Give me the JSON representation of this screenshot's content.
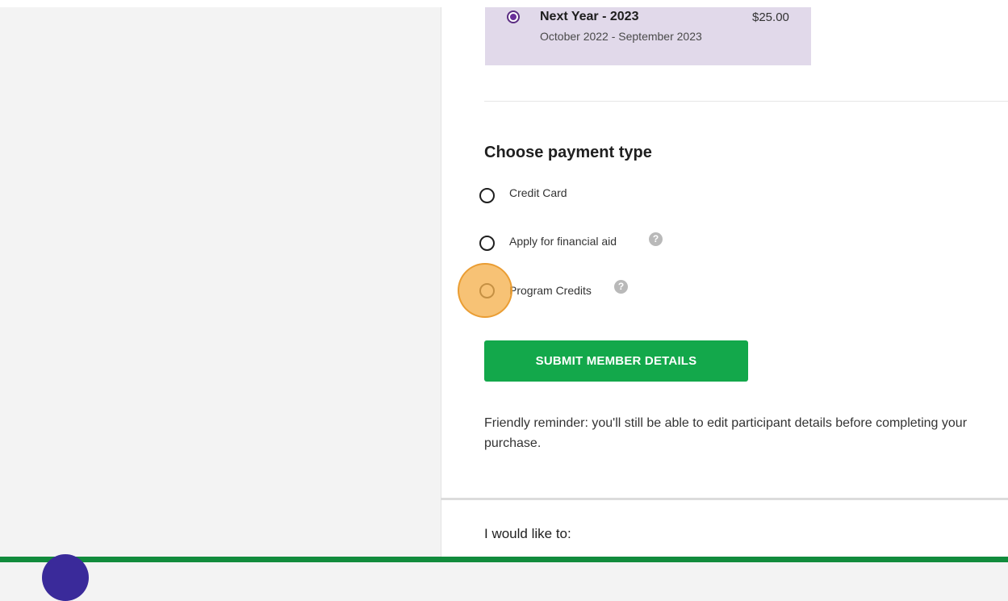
{
  "membership_option": {
    "title": "Next Year - 2023",
    "price": "$25.00",
    "period": "October 2022 - September 2023",
    "selected": true
  },
  "payment": {
    "heading": "Choose payment type",
    "options": [
      {
        "label": "Credit Card",
        "help": false
      },
      {
        "label": "Apply for financial aid",
        "help": true
      },
      {
        "label": "Program Credits",
        "help": true
      }
    ],
    "help_glyph": "?"
  },
  "submit": {
    "label": "SUBMIT MEMBER DETAILS"
  },
  "reminder": "Friendly reminder: you'll still be able to edit participant details before completing your purchase.",
  "next_section": {
    "heading": "I would like to:"
  },
  "colors": {
    "accent_green": "#13a84b",
    "selected_purple": "#6a2f9a",
    "card_bg": "#e1d9ea",
    "footer_green": "#118b3c"
  },
  "icons": [
    "radio-selected-icon",
    "radio-unselected-icon",
    "help-icon"
  ]
}
